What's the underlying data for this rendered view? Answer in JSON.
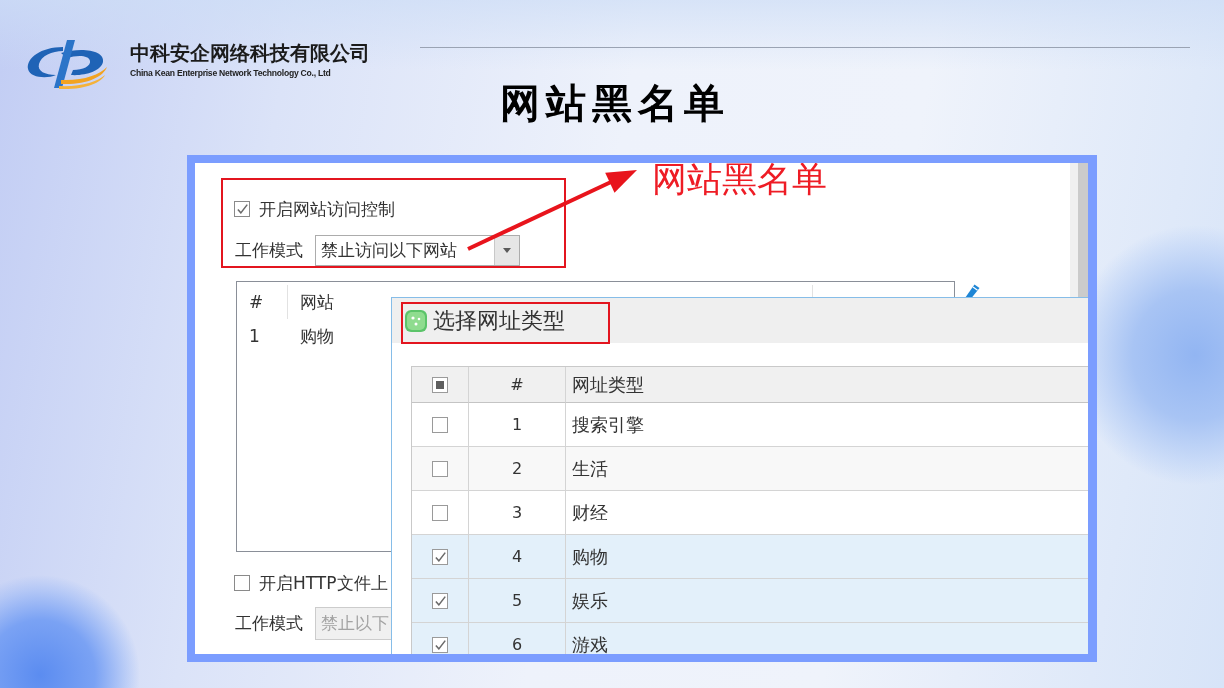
{
  "company": {
    "name": "中科安企网络科技有限公司",
    "name_en": "China Kean Enterprise Network Technology Co., Ltd"
  },
  "title": "网站黑名单",
  "screenshot": {
    "annotation": "网站黑名单",
    "access_control": {
      "label": "开启网站访问控制",
      "checked": true
    },
    "work_mode": {
      "label": "工作模式",
      "value": "禁止访问以下网站",
      "disabled": false
    },
    "website_table": {
      "columns": [
        "#",
        "网站"
      ],
      "rows": [
        {
          "number": "1",
          "website": "购物"
        }
      ]
    },
    "http_upload": {
      "label": "开启HTTP文件上",
      "checked": false
    },
    "upload_work_mode": {
      "label": "工作模式",
      "value": "禁止以下",
      "disabled": true
    },
    "dialog": {
      "title": "选择网址类型",
      "select_all": {
        "indeterminate": true
      },
      "columns": [
        "#",
        "网址类型"
      ],
      "rows": [
        {
          "number": "1",
          "type": "搜索引擎",
          "checked": false
        },
        {
          "number": "2",
          "type": "生活",
          "checked": false
        },
        {
          "number": "3",
          "type": "财经",
          "checked": false
        },
        {
          "number": "4",
          "type": "购物",
          "checked": true
        },
        {
          "number": "5",
          "type": "娱乐",
          "checked": true
        },
        {
          "number": "6",
          "type": "游戏",
          "checked": true
        }
      ]
    }
  }
}
